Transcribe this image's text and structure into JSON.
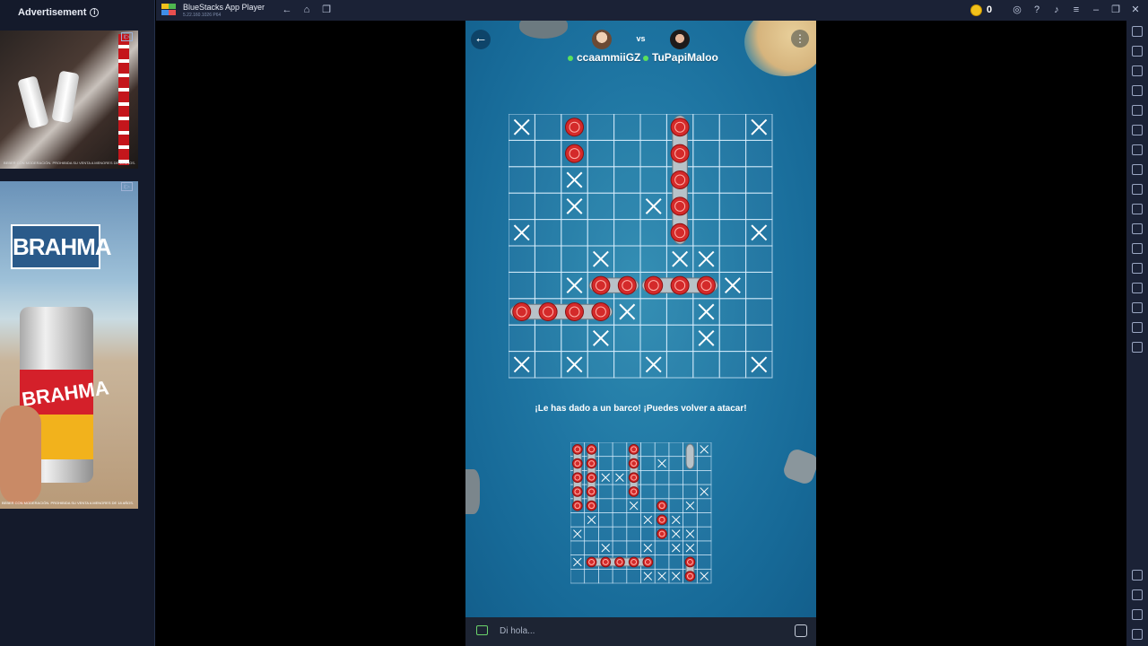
{
  "ad_panel": {
    "title": "Advertisement",
    "badge": "i▷",
    "ad1_fine_print": "BEBER CON MODERACIÓN. PROHIBIDA SU VENTA A MENORES DE 18 AÑOS.",
    "ad2_brand": "BRAHMA",
    "ad2_can_name": "BRAHMA",
    "ad2_fine_print": "BEBER CON MODERACIÓN. PROHIBIDA SU VENTA A MENORES DE 18 AÑOS."
  },
  "topbar": {
    "title": "BlueStacks App Player",
    "version": "5.22.160.1026  P64",
    "coins": "0"
  },
  "game": {
    "vs": "vs",
    "player1": "ccaammiiGZ",
    "player2": "TuPapiMaloo",
    "message": "¡Le has dado a un barco! ¡Puedes volver a atacar!",
    "board": {
      "size": 10,
      "misses": [
        [
          0,
          0
        ],
        [
          0,
          9
        ],
        [
          2,
          2
        ],
        [
          3,
          2
        ],
        [
          3,
          5
        ],
        [
          4,
          0
        ],
        [
          4,
          9
        ],
        [
          5,
          3
        ],
        [
          5,
          6
        ],
        [
          5,
          7
        ],
        [
          6,
          2
        ],
        [
          6,
          8
        ],
        [
          7,
          4
        ],
        [
          7,
          7
        ],
        [
          8,
          3
        ],
        [
          8,
          7
        ],
        [
          9,
          0
        ],
        [
          9,
          2
        ],
        [
          9,
          5
        ],
        [
          9,
          9
        ]
      ],
      "hits": [
        [
          0,
          2
        ],
        [
          1,
          2
        ],
        [
          0,
          6
        ],
        [
          1,
          6
        ],
        [
          2,
          6
        ],
        [
          3,
          6
        ],
        [
          4,
          6
        ],
        [
          6,
          3
        ],
        [
          6,
          4
        ],
        [
          6,
          5
        ],
        [
          6,
          6
        ],
        [
          6,
          7
        ],
        [
          7,
          0
        ],
        [
          7,
          1
        ],
        [
          7,
          2
        ],
        [
          7,
          3
        ]
      ],
      "ships": [
        {
          "row": 0,
          "col": 6,
          "len": 5,
          "dir": "v"
        },
        {
          "row": 6,
          "col": 3,
          "len": 2,
          "dir": "h"
        },
        {
          "row": 6,
          "col": 5,
          "len": 3,
          "dir": "h"
        },
        {
          "row": 7,
          "col": 0,
          "len": 4,
          "dir": "h"
        }
      ]
    },
    "mini_board": {
      "size": 10,
      "misses": [
        [
          0,
          9
        ],
        [
          1,
          6
        ],
        [
          2,
          2
        ],
        [
          2,
          3
        ],
        [
          3,
          9
        ],
        [
          4,
          4
        ],
        [
          4,
          8
        ],
        [
          5,
          1
        ],
        [
          5,
          5
        ],
        [
          5,
          7
        ],
        [
          6,
          0
        ],
        [
          6,
          6
        ],
        [
          6,
          7
        ],
        [
          6,
          8
        ],
        [
          7,
          2
        ],
        [
          7,
          5
        ],
        [
          7,
          7
        ],
        [
          7,
          8
        ],
        [
          8,
          0
        ],
        [
          9,
          5
        ],
        [
          9,
          6
        ],
        [
          9,
          7
        ],
        [
          9,
          9
        ]
      ],
      "hits": [
        [
          0,
          0
        ],
        [
          0,
          1
        ],
        [
          1,
          0
        ],
        [
          1,
          1
        ],
        [
          2,
          0
        ],
        [
          2,
          1
        ],
        [
          3,
          0
        ],
        [
          3,
          1
        ],
        [
          4,
          0
        ],
        [
          4,
          1
        ],
        [
          0,
          4
        ],
        [
          1,
          4
        ],
        [
          2,
          4
        ],
        [
          3,
          4
        ],
        [
          4,
          6
        ],
        [
          5,
          6
        ],
        [
          6,
          6
        ],
        [
          8,
          1
        ],
        [
          8,
          2
        ],
        [
          8,
          3
        ],
        [
          8,
          4
        ],
        [
          8,
          5
        ],
        [
          8,
          8
        ],
        [
          9,
          8
        ]
      ],
      "ships": [
        {
          "row": 0,
          "col": 0,
          "len": 5,
          "dir": "v"
        },
        {
          "row": 0,
          "col": 1,
          "len": 5,
          "dir": "v"
        },
        {
          "row": 0,
          "col": 4,
          "len": 4,
          "dir": "v"
        },
        {
          "row": 0,
          "col": 8,
          "len": 2,
          "dir": "v"
        },
        {
          "row": 8,
          "col": 1,
          "len": 5,
          "dir": "h"
        },
        {
          "row": 8,
          "col": 8,
          "len": 2,
          "dir": "v"
        }
      ]
    }
  },
  "chat": {
    "placeholder": "Di hola..."
  }
}
